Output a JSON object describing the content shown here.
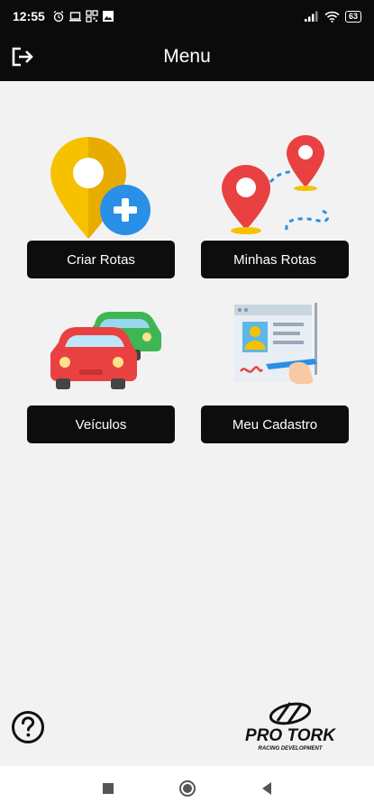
{
  "status_bar": {
    "time": "12:55",
    "battery": "63",
    "icons": [
      "alarm-icon",
      "laptop-icon",
      "qr-icon",
      "gallery-icon",
      "signal-icon",
      "wifi-icon",
      "battery-icon"
    ]
  },
  "app_bar": {
    "title": "Menu",
    "logout_icon": "logout-icon"
  },
  "menu": {
    "criar_rotas": "Criar Rotas",
    "minhas_rotas": "Minhas Rotas",
    "veiculos": "Veículos",
    "meu_cadastro": "Meu Cadastro"
  },
  "footer": {
    "help_icon": "help-icon",
    "logo_name": "PRO TORK",
    "logo_tagline": "RACING DEVELOPMENT"
  },
  "nav_bar": {
    "icons": [
      "recent-apps-icon",
      "home-icon",
      "back-icon"
    ]
  },
  "colors": {
    "bar_bg": "#0b0b0b",
    "page_bg": "#f2f2f2",
    "button_bg": "#0d0d0d",
    "pin_yellow": "#f6c200",
    "plus_blue": "#2a8fe6",
    "pin_red": "#e94141"
  }
}
